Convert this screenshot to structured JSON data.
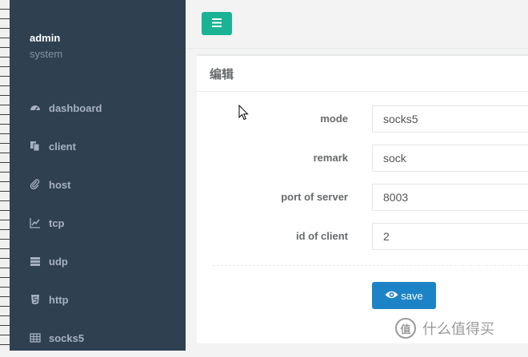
{
  "profile": {
    "name": "admin",
    "role": "system"
  },
  "nav": {
    "items": [
      {
        "label": "dashboard",
        "icon": "dashboard-icon"
      },
      {
        "label": "client",
        "icon": "copy-icon"
      },
      {
        "label": "host",
        "icon": "paperclip-icon"
      },
      {
        "label": "tcp",
        "icon": "line-chart-icon"
      },
      {
        "label": "udp",
        "icon": "server-icon"
      },
      {
        "label": "http",
        "icon": "html5-icon"
      },
      {
        "label": "socks5",
        "icon": "table-icon"
      }
    ]
  },
  "topbar": {
    "menu_icon": "hamburger-icon",
    "accent": "#1ab394"
  },
  "panel": {
    "title": "编辑",
    "fields": {
      "mode": {
        "label": "mode",
        "value": "socks5"
      },
      "remark": {
        "label": "remark",
        "value": "sock"
      },
      "port": {
        "label": "port of server",
        "value": "8003"
      },
      "client_id": {
        "label": "id of client",
        "value": "2"
      }
    },
    "save_label": "save",
    "save_color": "#1c84c6"
  },
  "watermark": {
    "badge": "值",
    "text": "什么值得买"
  },
  "colors": {
    "sidebar": "#2f4050",
    "nav_text": "#a7b1c2",
    "background": "#f3f3f4"
  }
}
